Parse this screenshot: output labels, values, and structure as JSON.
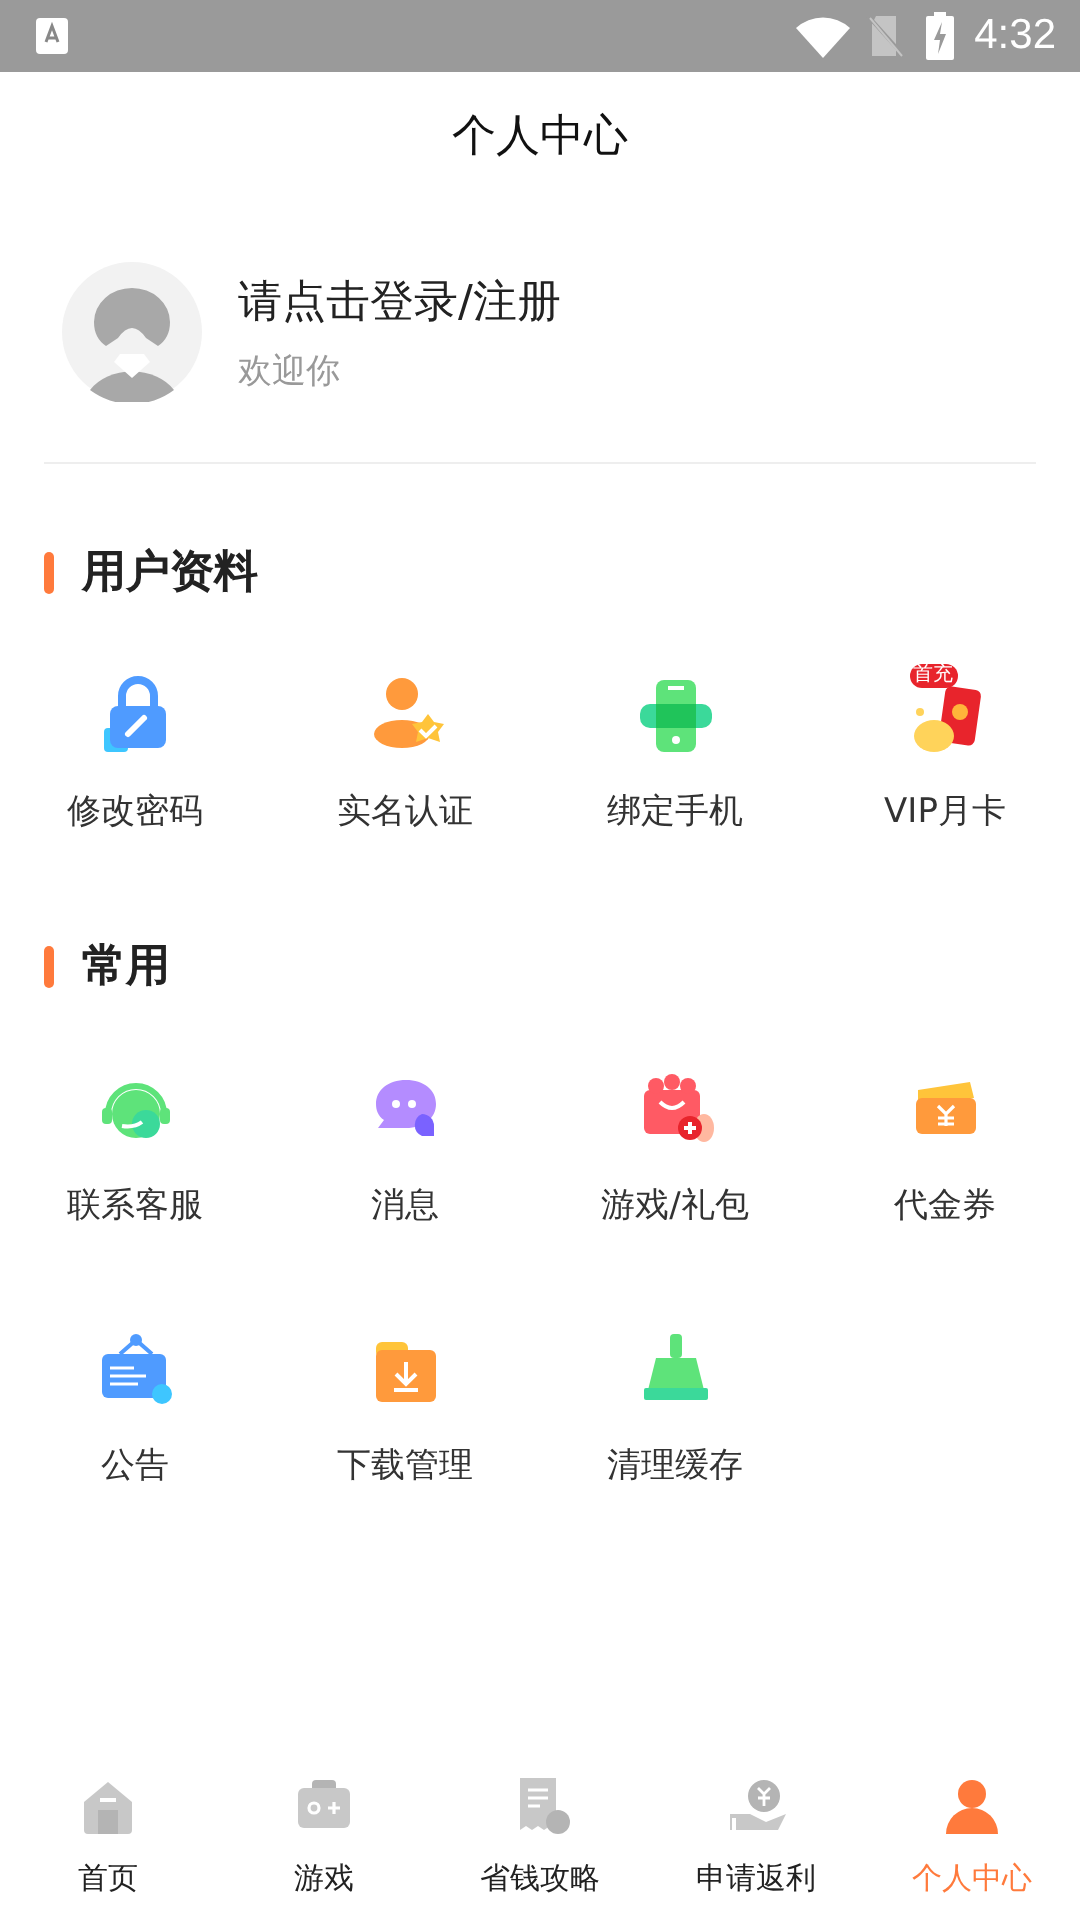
{
  "status_bar": {
    "time": "4:32"
  },
  "header": {
    "title": "个人中心"
  },
  "profile": {
    "name": "请点击登录/注册",
    "subtitle": "欢迎你"
  },
  "sections": [
    {
      "title": "用户资料",
      "items": [
        {
          "label": "修改密码",
          "kind": "lock"
        },
        {
          "label": "实名认证",
          "kind": "verify"
        },
        {
          "label": "绑定手机",
          "kind": "phone"
        },
        {
          "label": "VIP月卡",
          "kind": "vip",
          "badge": "首充"
        }
      ]
    },
    {
      "title": "常用",
      "items": [
        {
          "label": "联系客服",
          "kind": "headset"
        },
        {
          "label": "消息",
          "kind": "chat"
        },
        {
          "label": "游戏/礼包",
          "kind": "gift"
        },
        {
          "label": "代金券",
          "kind": "ticket"
        },
        {
          "label": "公告",
          "kind": "notice"
        },
        {
          "label": "下载管理",
          "kind": "download"
        },
        {
          "label": "清理缓存",
          "kind": "broom"
        }
      ]
    }
  ],
  "bottom_nav": [
    {
      "label": "首页",
      "kind": "home",
      "selected": false
    },
    {
      "label": "游戏",
      "kind": "game",
      "selected": false
    },
    {
      "label": "省钱攻略",
      "kind": "guide",
      "selected": false
    },
    {
      "label": "申请返利",
      "kind": "rebate",
      "selected": false
    },
    {
      "label": "个人中心",
      "kind": "me",
      "selected": true
    }
  ]
}
